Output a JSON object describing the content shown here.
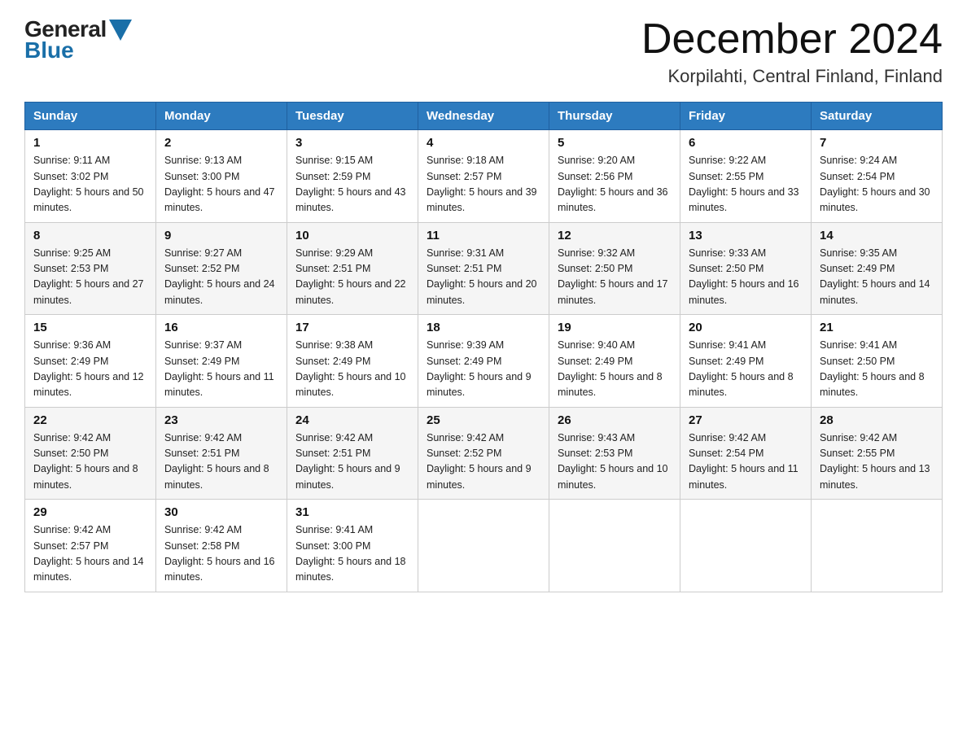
{
  "header": {
    "title": "December 2024",
    "subtitle": "Korpilahti, Central Finland, Finland",
    "logo_general": "General",
    "logo_blue": "Blue"
  },
  "weekdays": [
    "Sunday",
    "Monday",
    "Tuesday",
    "Wednesday",
    "Thursday",
    "Friday",
    "Saturday"
  ],
  "weeks": [
    [
      {
        "day": "1",
        "sunrise": "9:11 AM",
        "sunset": "3:02 PM",
        "daylight": "5 hours and 50 minutes."
      },
      {
        "day": "2",
        "sunrise": "9:13 AM",
        "sunset": "3:00 PM",
        "daylight": "5 hours and 47 minutes."
      },
      {
        "day": "3",
        "sunrise": "9:15 AM",
        "sunset": "2:59 PM",
        "daylight": "5 hours and 43 minutes."
      },
      {
        "day": "4",
        "sunrise": "9:18 AM",
        "sunset": "2:57 PM",
        "daylight": "5 hours and 39 minutes."
      },
      {
        "day": "5",
        "sunrise": "9:20 AM",
        "sunset": "2:56 PM",
        "daylight": "5 hours and 36 minutes."
      },
      {
        "day": "6",
        "sunrise": "9:22 AM",
        "sunset": "2:55 PM",
        "daylight": "5 hours and 33 minutes."
      },
      {
        "day": "7",
        "sunrise": "9:24 AM",
        "sunset": "2:54 PM",
        "daylight": "5 hours and 30 minutes."
      }
    ],
    [
      {
        "day": "8",
        "sunrise": "9:25 AM",
        "sunset": "2:53 PM",
        "daylight": "5 hours and 27 minutes."
      },
      {
        "day": "9",
        "sunrise": "9:27 AM",
        "sunset": "2:52 PM",
        "daylight": "5 hours and 24 minutes."
      },
      {
        "day": "10",
        "sunrise": "9:29 AM",
        "sunset": "2:51 PM",
        "daylight": "5 hours and 22 minutes."
      },
      {
        "day": "11",
        "sunrise": "9:31 AM",
        "sunset": "2:51 PM",
        "daylight": "5 hours and 20 minutes."
      },
      {
        "day": "12",
        "sunrise": "9:32 AM",
        "sunset": "2:50 PM",
        "daylight": "5 hours and 17 minutes."
      },
      {
        "day": "13",
        "sunrise": "9:33 AM",
        "sunset": "2:50 PM",
        "daylight": "5 hours and 16 minutes."
      },
      {
        "day": "14",
        "sunrise": "9:35 AM",
        "sunset": "2:49 PM",
        "daylight": "5 hours and 14 minutes."
      }
    ],
    [
      {
        "day": "15",
        "sunrise": "9:36 AM",
        "sunset": "2:49 PM",
        "daylight": "5 hours and 12 minutes."
      },
      {
        "day": "16",
        "sunrise": "9:37 AM",
        "sunset": "2:49 PM",
        "daylight": "5 hours and 11 minutes."
      },
      {
        "day": "17",
        "sunrise": "9:38 AM",
        "sunset": "2:49 PM",
        "daylight": "5 hours and 10 minutes."
      },
      {
        "day": "18",
        "sunrise": "9:39 AM",
        "sunset": "2:49 PM",
        "daylight": "5 hours and 9 minutes."
      },
      {
        "day": "19",
        "sunrise": "9:40 AM",
        "sunset": "2:49 PM",
        "daylight": "5 hours and 8 minutes."
      },
      {
        "day": "20",
        "sunrise": "9:41 AM",
        "sunset": "2:49 PM",
        "daylight": "5 hours and 8 minutes."
      },
      {
        "day": "21",
        "sunrise": "9:41 AM",
        "sunset": "2:50 PM",
        "daylight": "5 hours and 8 minutes."
      }
    ],
    [
      {
        "day": "22",
        "sunrise": "9:42 AM",
        "sunset": "2:50 PM",
        "daylight": "5 hours and 8 minutes."
      },
      {
        "day": "23",
        "sunrise": "9:42 AM",
        "sunset": "2:51 PM",
        "daylight": "5 hours and 8 minutes."
      },
      {
        "day": "24",
        "sunrise": "9:42 AM",
        "sunset": "2:51 PM",
        "daylight": "5 hours and 9 minutes."
      },
      {
        "day": "25",
        "sunrise": "9:42 AM",
        "sunset": "2:52 PM",
        "daylight": "5 hours and 9 minutes."
      },
      {
        "day": "26",
        "sunrise": "9:43 AM",
        "sunset": "2:53 PM",
        "daylight": "5 hours and 10 minutes."
      },
      {
        "day": "27",
        "sunrise": "9:42 AM",
        "sunset": "2:54 PM",
        "daylight": "5 hours and 11 minutes."
      },
      {
        "day": "28",
        "sunrise": "9:42 AM",
        "sunset": "2:55 PM",
        "daylight": "5 hours and 13 minutes."
      }
    ],
    [
      {
        "day": "29",
        "sunrise": "9:42 AM",
        "sunset": "2:57 PM",
        "daylight": "5 hours and 14 minutes."
      },
      {
        "day": "30",
        "sunrise": "9:42 AM",
        "sunset": "2:58 PM",
        "daylight": "5 hours and 16 minutes."
      },
      {
        "day": "31",
        "sunrise": "9:41 AM",
        "sunset": "3:00 PM",
        "daylight": "5 hours and 18 minutes."
      },
      null,
      null,
      null,
      null
    ]
  ]
}
